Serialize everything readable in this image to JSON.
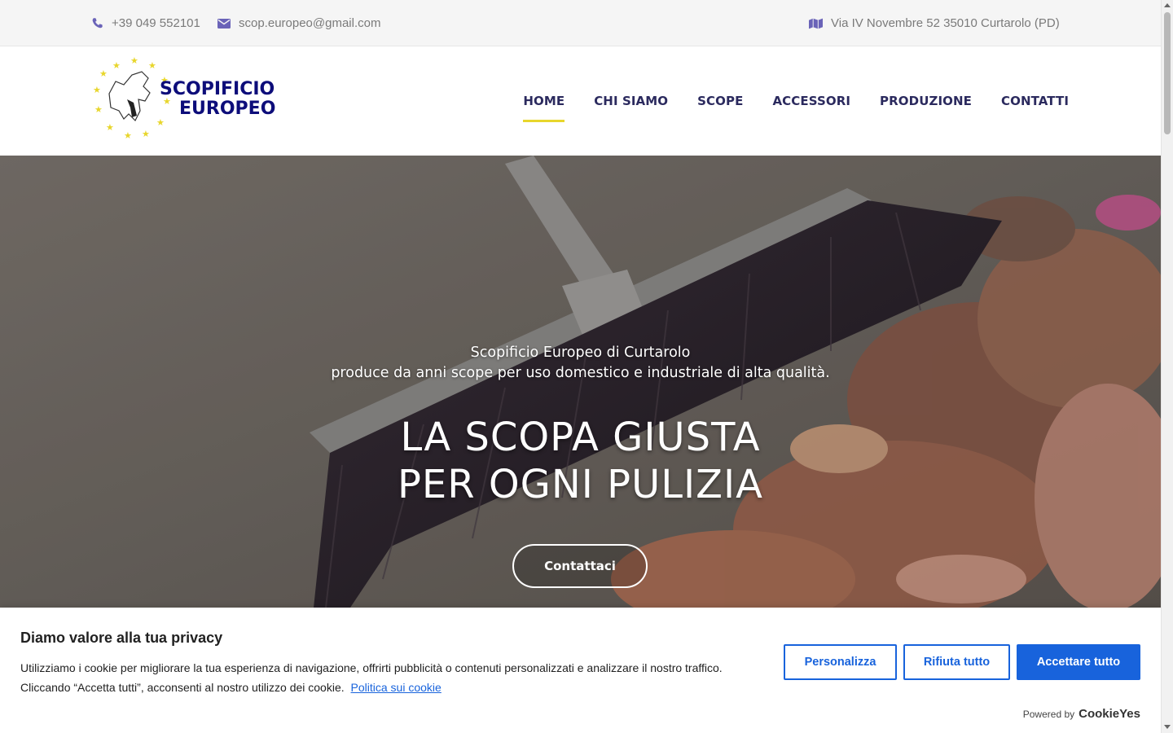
{
  "topbar": {
    "phone": "+39 049 552101",
    "email": "scop.europeo@gmail.com",
    "address": "Via IV Novembre 52 35010 Curtarolo (PD)"
  },
  "logo": {
    "line1": "SCOPIFICIO",
    "line2": "EUROPEO"
  },
  "nav": {
    "items": [
      {
        "label": "HOME",
        "active": true
      },
      {
        "label": "CHI SIAMO"
      },
      {
        "label": "SCOPE"
      },
      {
        "label": "ACCESSORI"
      },
      {
        "label": "PRODUZIONE"
      },
      {
        "label": "CONTATTI"
      }
    ]
  },
  "hero": {
    "subtitle_line1": "Scopificio Europeo di Curtarolo",
    "subtitle_line2": "produce da anni scope per uso domestico e industriale di alta qualità.",
    "title_line1": "LA SCOPA GIUSTA",
    "title_line2": "PER OGNI PULIZIA",
    "cta_label": "Contattaci"
  },
  "cookie": {
    "title": "Diamo valore alla tua privacy",
    "text_line1": "Utilizziamo i cookie per migliorare la tua esperienza di navigazione, offrirti pubblicità o contenuti personalizzati e analizzare il nostro traffico.",
    "text_line2": "Cliccando “Accetta tutti”, acconsenti al nostro utilizzo dei cookie.",
    "policy_link": "Politica sui cookie",
    "btn_customize": "Personalizza",
    "btn_reject": "Rifiuta tutto",
    "btn_accept": "Accettare tutto",
    "powered_by": "Powered by",
    "powered_brand": "CookieYes"
  },
  "colors": {
    "nav_text": "#2b2a5e",
    "active_underline": "#e8d62c",
    "icon": "#6a63b8",
    "cookie_accent": "#1863dc"
  }
}
